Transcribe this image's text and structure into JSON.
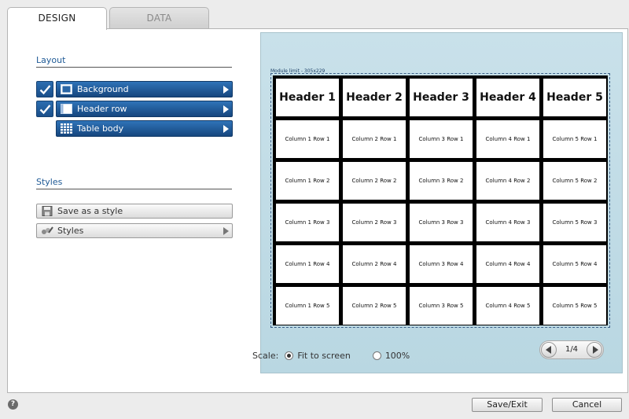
{
  "tabs": {
    "design": "DESIGN",
    "data": "DATA"
  },
  "layout": {
    "title": "Layout",
    "items": [
      {
        "label": "Background",
        "checked": true,
        "icon": "background-icon"
      },
      {
        "label": "Header row",
        "checked": true,
        "icon": "header-row-icon"
      },
      {
        "label": "Table body",
        "checked": false,
        "icon": "table-body-icon"
      }
    ]
  },
  "styles": {
    "title": "Styles",
    "save_label": "Save as a style",
    "styles_label": "Styles"
  },
  "preview": {
    "module_limit": "Module limit - 305x229",
    "headers": [
      "Header 1",
      "Header 2",
      "Header 3",
      "Header 4",
      "Header 5"
    ],
    "rows": [
      [
        "Column 1 Row 1",
        "Column 2 Row 1",
        "Column 3 Row 1",
        "Column 4 Row 1",
        "Column 5 Row 1"
      ],
      [
        "Column 1 Row 2",
        "Column 2 Row 2",
        "Column 3 Row 2",
        "Column 4 Row 2",
        "Column 5 Row 2"
      ],
      [
        "Column 1 Row 3",
        "Column 2 Row 3",
        "Column 3 Row 3",
        "Column 4 Row 3",
        "Column 5 Row 3"
      ],
      [
        "Column 1 Row 4",
        "Column 2 Row 4",
        "Column 3 Row 4",
        "Column 4 Row 4",
        "Column 5 Row 4"
      ],
      [
        "Column 1 Row 5",
        "Column 2 Row 5",
        "Column 3 Row 5",
        "Column 4 Row 5",
        "Column 5 Row 5"
      ]
    ],
    "page_indicator": "1/4"
  },
  "scale": {
    "label": "Scale:",
    "fit_label": "Fit to screen",
    "percent_label": "100%",
    "selected": "fit"
  },
  "footer": {
    "help": "?",
    "save_exit": "Save/Exit",
    "cancel": "Cancel"
  },
  "colors": {
    "accent": "#1f5a96",
    "preview_bg": "#c4dde7"
  }
}
